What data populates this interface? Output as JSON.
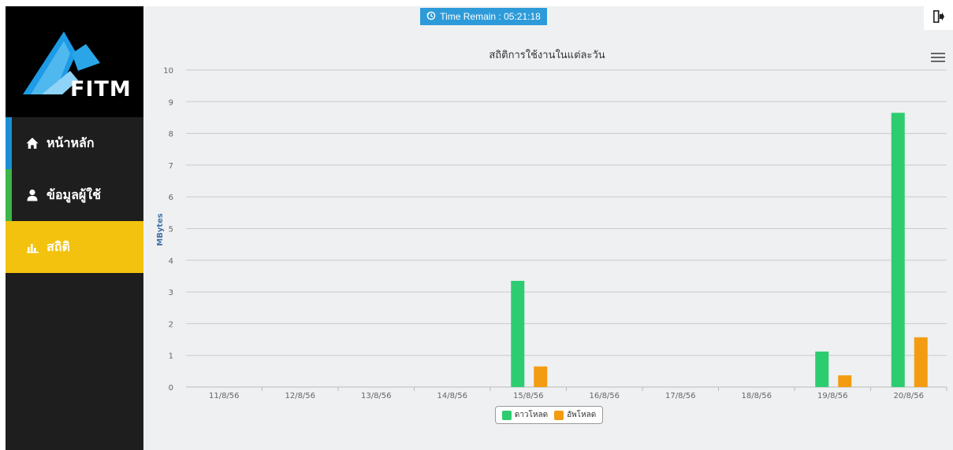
{
  "sidebar": {
    "logo_text": "FITM",
    "items": [
      {
        "label": "หน้าหลัก",
        "icon": "home-icon",
        "stripe_color": "#1a8fd4"
      },
      {
        "label": "ข้อมูลผู้ใช้",
        "icon": "user-icon",
        "stripe_color": "#3cb54a"
      },
      {
        "label": "สถิติ",
        "icon": "bar-chart-icon",
        "active": true,
        "active_color": "#f2c20f"
      }
    ]
  },
  "header": {
    "time_remain_label": "Time Remain : 05:21:18",
    "timer_icon": "history-icon",
    "logout_icon": "sign-out-icon",
    "menu_icon": "hamburger-menu-icon"
  },
  "chart_data": {
    "type": "bar",
    "title": "สถิติการใช้งานในแต่ละวัน",
    "ylabel": "MBytes",
    "xlabel": "",
    "ylim": [
      0,
      10
    ],
    "yticks": [
      0,
      1,
      2,
      3,
      4,
      5,
      6,
      7,
      8,
      9,
      10
    ],
    "grid": true,
    "legend_position": "bottom-center",
    "categories": [
      "11/8/56",
      "12/8/56",
      "13/8/56",
      "14/8/56",
      "15/8/56",
      "16/8/56",
      "17/8/56",
      "18/8/56",
      "19/8/56",
      "20/8/56"
    ],
    "series": [
      {
        "name": "ดาวโหลด",
        "color": "#2ecc71",
        "values": [
          0,
          0,
          0,
          0,
          3.35,
          0,
          0,
          0,
          1.12,
          8.65
        ]
      },
      {
        "name": "อัพโหลด",
        "color": "#f39c12",
        "values": [
          0,
          0,
          0,
          0,
          0.65,
          0,
          0,
          0,
          0.37,
          1.57
        ]
      }
    ]
  }
}
